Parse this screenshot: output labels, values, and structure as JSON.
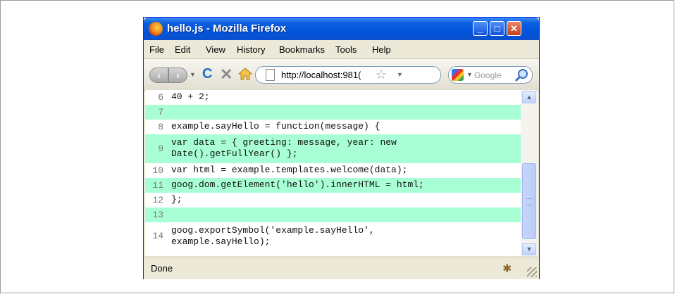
{
  "window": {
    "title": "hello.js - Mozilla Firefox"
  },
  "menu": [
    "File",
    "Edit",
    "View",
    "History",
    "Bookmarks",
    "Tools",
    "Help"
  ],
  "navbar": {
    "url": "http://localhost:981(",
    "search_placeholder": "Google"
  },
  "lines": [
    {
      "num": "6",
      "text": "40 + 2;",
      "highlight": false
    },
    {
      "num": "7",
      "text": "",
      "highlight": true
    },
    {
      "num": "8",
      "text": "example.sayHello = function(message) {",
      "highlight": false
    },
    {
      "num": "9",
      "text": "var data = { greeting: message, year: new\nDate().getFullYear() };",
      "highlight": true
    },
    {
      "num": "10",
      "text": "var html = example.templates.welcome(data);",
      "highlight": false
    },
    {
      "num": "11",
      "text": "goog.dom.getElement('hello').innerHTML = html;",
      "highlight": true
    },
    {
      "num": "12",
      "text": "};",
      "highlight": false
    },
    {
      "num": "13",
      "text": "",
      "highlight": true
    },
    {
      "num": "14",
      "text": "goog.exportSymbol('example.sayHello',\nexample.sayHello);",
      "highlight": false
    }
  ],
  "status": {
    "text": "Done"
  },
  "colors": {
    "highlight": "#a8ffd6",
    "titlebar": "#0354dc"
  }
}
